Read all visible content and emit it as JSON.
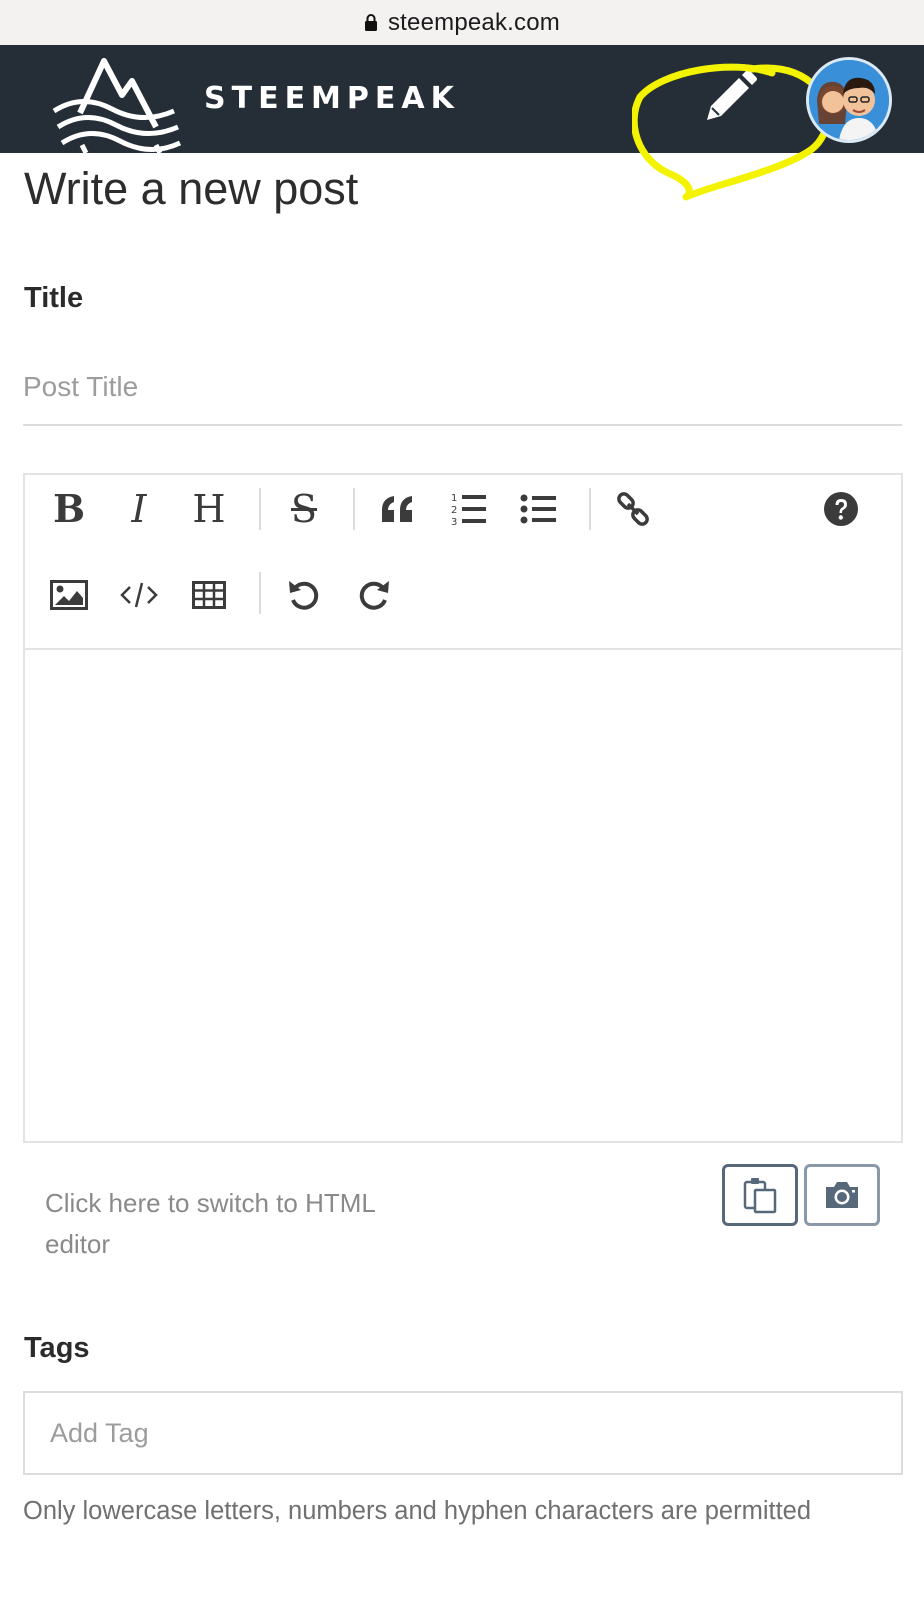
{
  "browser": {
    "url": "steempeak.com",
    "lock_icon": "lock-icon"
  },
  "header": {
    "brand_name": "STEEMPEAK",
    "logo_icon": "steempeak-logo",
    "write_icon": "pencil-icon",
    "avatar_icon": "user-avatar",
    "highlight_color": "#f3f300",
    "background": "#252e37"
  },
  "page": {
    "title": "Write a new post"
  },
  "form": {
    "title_label": "Title",
    "title_placeholder": "Post Title",
    "title_value": "",
    "tags_label": "Tags",
    "tags_placeholder": "Add Tag",
    "tags_hint": "Only lowercase letters, numbers and hyphen characters are permitted"
  },
  "editor": {
    "toolbar_row1": [
      {
        "name": "bold",
        "glyph": "B"
      },
      {
        "name": "italic",
        "glyph": "I"
      },
      {
        "name": "heading",
        "glyph": "H"
      },
      {
        "name": "strikethrough",
        "glyph": "S"
      },
      {
        "name": "quote",
        "icon": "quote-icon"
      },
      {
        "name": "ordered-list",
        "icon": "ordered-list-icon"
      },
      {
        "name": "unordered-list",
        "icon": "unordered-list-icon"
      },
      {
        "name": "link",
        "icon": "link-icon"
      },
      {
        "name": "help",
        "icon": "help-icon"
      }
    ],
    "toolbar_row2": [
      {
        "name": "image",
        "icon": "image-icon"
      },
      {
        "name": "code",
        "icon": "code-icon"
      },
      {
        "name": "table",
        "icon": "table-icon"
      },
      {
        "name": "undo",
        "icon": "undo-icon"
      },
      {
        "name": "redo",
        "icon": "redo-icon"
      }
    ],
    "content": "",
    "switch_html_label": "Click here to switch to HTML editor",
    "paste_icon": "paste-icon",
    "camera_icon": "camera-icon"
  }
}
